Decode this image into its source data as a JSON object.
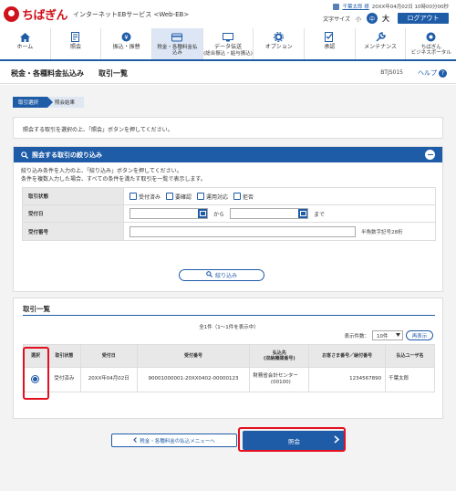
{
  "header": {
    "brand": "ちばぎん",
    "service": "インターネットEBサービス <Web-EB>",
    "user_name": "千葉太郎 様",
    "last_login": "20XX年04月02日 10時00分00秒",
    "font_size_label": "文字サイズ",
    "font_small": "小",
    "font_medium": "中",
    "font_large": "大",
    "logout": "ログアウト"
  },
  "nav": {
    "items": [
      {
        "label": "ホーム",
        "icon": "home-icon"
      },
      {
        "label": "照会",
        "icon": "inquiry-icon"
      },
      {
        "label": "振込・振替",
        "icon": "transfer-icon"
      },
      {
        "label": "税金・各種料金払込み",
        "icon": "tax-payment-icon",
        "active": true
      },
      {
        "label": "データ伝送",
        "sub": "(総合振込・給与振込)",
        "icon": "data-transfer-icon"
      },
      {
        "label": "オプション",
        "icon": "option-icon"
      },
      {
        "label": "承認",
        "icon": "approval-icon"
      },
      {
        "label": "メンテナンス",
        "icon": "maintenance-icon"
      },
      {
        "label": "ちばぎん",
        "sub": "ビジネスポータル",
        "icon": "portal-icon"
      }
    ]
  },
  "page": {
    "title": "税金・各種料金払込み　　取引一覧",
    "screen_id": "BTJS015",
    "help": "ヘルプ"
  },
  "steps": [
    "取引選択",
    "照会結果"
  ],
  "instruction": "照会する取引を選択の上、「照会」ボタンを押してください。",
  "filter": {
    "title": "照会する取引の絞り込み",
    "desc1": "絞り込み条件を入力の上、「絞り込み」ボタンを押してください。",
    "desc2": "条件を複数入力した場合、すべての条件を満たす取引を一覧で表示します。",
    "status_label": "取引状態",
    "status_options": [
      "受付済み",
      "要確認",
      "運用対応",
      "拒否"
    ],
    "date_label": "受付日",
    "date_from_sep": "から",
    "date_to_sep": "まで",
    "number_label": "受付番号",
    "number_hint": "半角数字記号28桁",
    "button": "絞り込み"
  },
  "list": {
    "title": "取引一覧",
    "count": "全1件（1～1件を表示中）",
    "display_label": "表示件数：",
    "display_value": "10件",
    "redisplay": "再表示",
    "headers": [
      "選択",
      "取引状態",
      "受付日",
      "受付番号",
      "払込先\n(収納機関番号)",
      "お客さま番号／納付番号",
      "払込ユーザ名"
    ],
    "rows": [
      {
        "status": "受付済み",
        "date": "20XX年04月02日",
        "number": "90001000001-20XX0402-00000123",
        "payee": "財務省会計センター",
        "payee_code": "(00100)",
        "customer_no": "1234567890",
        "user": "千葉太郎"
      }
    ]
  },
  "buttons": {
    "back": "税金・各種料金の払込メニューへ",
    "inquiry": "照会"
  },
  "colors": {
    "accent": "#1f5ca8",
    "brand": "#d0121b",
    "highlight": "#e3101f"
  }
}
